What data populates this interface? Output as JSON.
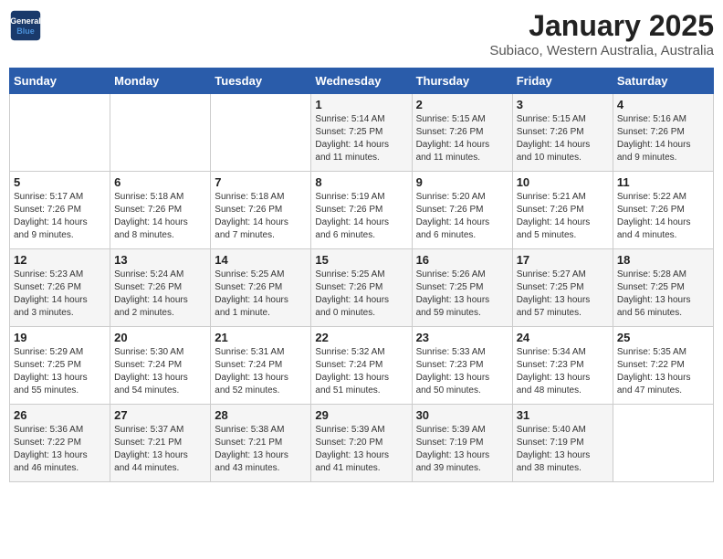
{
  "header": {
    "logo_line1": "General",
    "logo_line2": "Blue",
    "month_year": "January 2025",
    "location": "Subiaco, Western Australia, Australia"
  },
  "weekdays": [
    "Sunday",
    "Monday",
    "Tuesday",
    "Wednesday",
    "Thursday",
    "Friday",
    "Saturday"
  ],
  "weeks": [
    [
      {
        "day": "",
        "info": ""
      },
      {
        "day": "",
        "info": ""
      },
      {
        "day": "",
        "info": ""
      },
      {
        "day": "1",
        "info": "Sunrise: 5:14 AM\nSunset: 7:25 PM\nDaylight: 14 hours\nand 11 minutes."
      },
      {
        "day": "2",
        "info": "Sunrise: 5:15 AM\nSunset: 7:26 PM\nDaylight: 14 hours\nand 11 minutes."
      },
      {
        "day": "3",
        "info": "Sunrise: 5:15 AM\nSunset: 7:26 PM\nDaylight: 14 hours\nand 10 minutes."
      },
      {
        "day": "4",
        "info": "Sunrise: 5:16 AM\nSunset: 7:26 PM\nDaylight: 14 hours\nand 9 minutes."
      }
    ],
    [
      {
        "day": "5",
        "info": "Sunrise: 5:17 AM\nSunset: 7:26 PM\nDaylight: 14 hours\nand 9 minutes."
      },
      {
        "day": "6",
        "info": "Sunrise: 5:18 AM\nSunset: 7:26 PM\nDaylight: 14 hours\nand 8 minutes."
      },
      {
        "day": "7",
        "info": "Sunrise: 5:18 AM\nSunset: 7:26 PM\nDaylight: 14 hours\nand 7 minutes."
      },
      {
        "day": "8",
        "info": "Sunrise: 5:19 AM\nSunset: 7:26 PM\nDaylight: 14 hours\nand 6 minutes."
      },
      {
        "day": "9",
        "info": "Sunrise: 5:20 AM\nSunset: 7:26 PM\nDaylight: 14 hours\nand 6 minutes."
      },
      {
        "day": "10",
        "info": "Sunrise: 5:21 AM\nSunset: 7:26 PM\nDaylight: 14 hours\nand 5 minutes."
      },
      {
        "day": "11",
        "info": "Sunrise: 5:22 AM\nSunset: 7:26 PM\nDaylight: 14 hours\nand 4 minutes."
      }
    ],
    [
      {
        "day": "12",
        "info": "Sunrise: 5:23 AM\nSunset: 7:26 PM\nDaylight: 14 hours\nand 3 minutes."
      },
      {
        "day": "13",
        "info": "Sunrise: 5:24 AM\nSunset: 7:26 PM\nDaylight: 14 hours\nand 2 minutes."
      },
      {
        "day": "14",
        "info": "Sunrise: 5:25 AM\nSunset: 7:26 PM\nDaylight: 14 hours\nand 1 minute."
      },
      {
        "day": "15",
        "info": "Sunrise: 5:25 AM\nSunset: 7:26 PM\nDaylight: 14 hours\nand 0 minutes."
      },
      {
        "day": "16",
        "info": "Sunrise: 5:26 AM\nSunset: 7:25 PM\nDaylight: 13 hours\nand 59 minutes."
      },
      {
        "day": "17",
        "info": "Sunrise: 5:27 AM\nSunset: 7:25 PM\nDaylight: 13 hours\nand 57 minutes."
      },
      {
        "day": "18",
        "info": "Sunrise: 5:28 AM\nSunset: 7:25 PM\nDaylight: 13 hours\nand 56 minutes."
      }
    ],
    [
      {
        "day": "19",
        "info": "Sunrise: 5:29 AM\nSunset: 7:25 PM\nDaylight: 13 hours\nand 55 minutes."
      },
      {
        "day": "20",
        "info": "Sunrise: 5:30 AM\nSunset: 7:24 PM\nDaylight: 13 hours\nand 54 minutes."
      },
      {
        "day": "21",
        "info": "Sunrise: 5:31 AM\nSunset: 7:24 PM\nDaylight: 13 hours\nand 52 minutes."
      },
      {
        "day": "22",
        "info": "Sunrise: 5:32 AM\nSunset: 7:24 PM\nDaylight: 13 hours\nand 51 minutes."
      },
      {
        "day": "23",
        "info": "Sunrise: 5:33 AM\nSunset: 7:23 PM\nDaylight: 13 hours\nand 50 minutes."
      },
      {
        "day": "24",
        "info": "Sunrise: 5:34 AM\nSunset: 7:23 PM\nDaylight: 13 hours\nand 48 minutes."
      },
      {
        "day": "25",
        "info": "Sunrise: 5:35 AM\nSunset: 7:22 PM\nDaylight: 13 hours\nand 47 minutes."
      }
    ],
    [
      {
        "day": "26",
        "info": "Sunrise: 5:36 AM\nSunset: 7:22 PM\nDaylight: 13 hours\nand 46 minutes."
      },
      {
        "day": "27",
        "info": "Sunrise: 5:37 AM\nSunset: 7:21 PM\nDaylight: 13 hours\nand 44 minutes."
      },
      {
        "day": "28",
        "info": "Sunrise: 5:38 AM\nSunset: 7:21 PM\nDaylight: 13 hours\nand 43 minutes."
      },
      {
        "day": "29",
        "info": "Sunrise: 5:39 AM\nSunset: 7:20 PM\nDaylight: 13 hours\nand 41 minutes."
      },
      {
        "day": "30",
        "info": "Sunrise: 5:39 AM\nSunset: 7:19 PM\nDaylight: 13 hours\nand 39 minutes."
      },
      {
        "day": "31",
        "info": "Sunrise: 5:40 AM\nSunset: 7:19 PM\nDaylight: 13 hours\nand 38 minutes."
      },
      {
        "day": "",
        "info": ""
      }
    ]
  ]
}
